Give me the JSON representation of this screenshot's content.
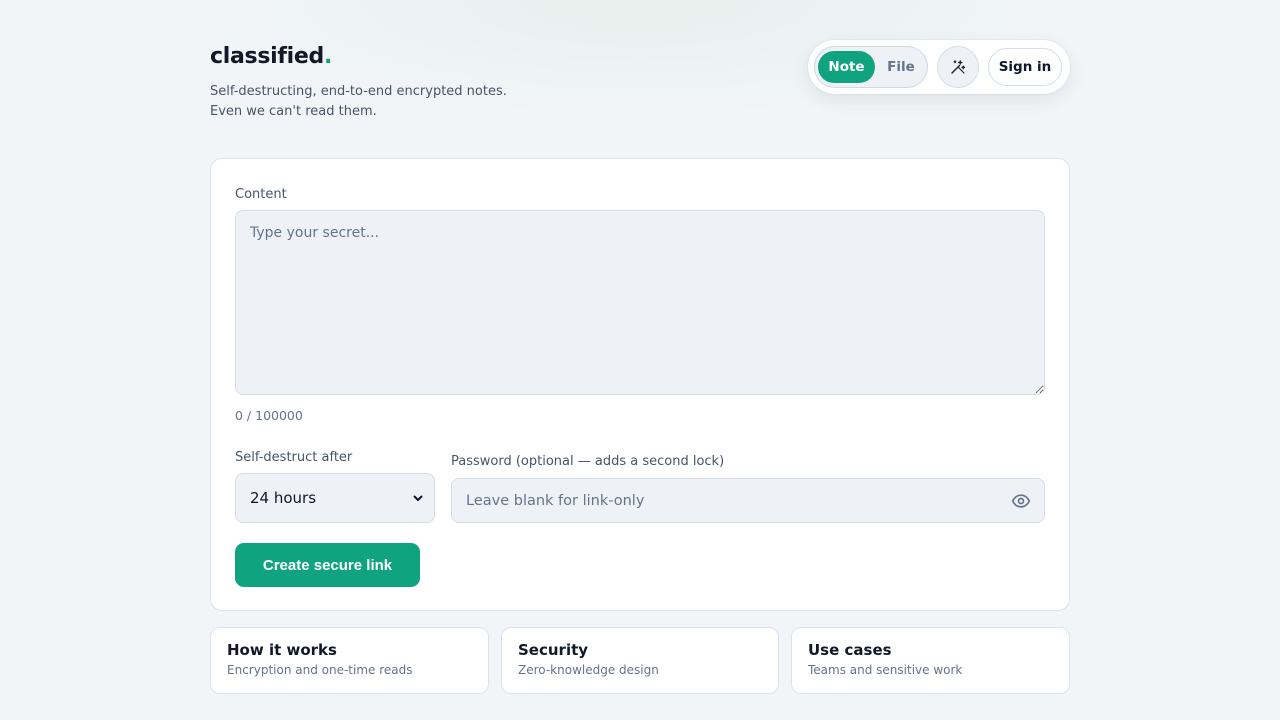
{
  "header": {
    "brand_name": "classified",
    "brand_dot": ".",
    "tagline_line1": "Self-destructing, end-to-end encrypted notes.",
    "tagline_line2": "Even we can't read them."
  },
  "toolbar": {
    "mode_note": "Note",
    "mode_file": "File",
    "active_mode": "Note",
    "magic_icon": "magic-wand-icon",
    "sign_in": "Sign in"
  },
  "form": {
    "content_label": "Content",
    "content_placeholder": "Type your secret...",
    "counter": "0 / 100000",
    "destruct_label": "Self-destruct after",
    "destruct_selected": "24 hours",
    "password_label": "Password (optional — adds a second lock)",
    "password_placeholder": "Leave blank for link-only",
    "create_button": "Create secure link"
  },
  "tiles": [
    {
      "title": "How it works",
      "subtitle": "Encryption and one-time reads"
    },
    {
      "title": "Security",
      "subtitle": "Zero-knowledge design"
    },
    {
      "title": "Use cases",
      "subtitle": "Teams and sensitive work"
    }
  ],
  "colors": {
    "accent": "#10a37f",
    "background": "#f1f5f8",
    "card": "#ffffff",
    "field": "#eef2f6"
  }
}
